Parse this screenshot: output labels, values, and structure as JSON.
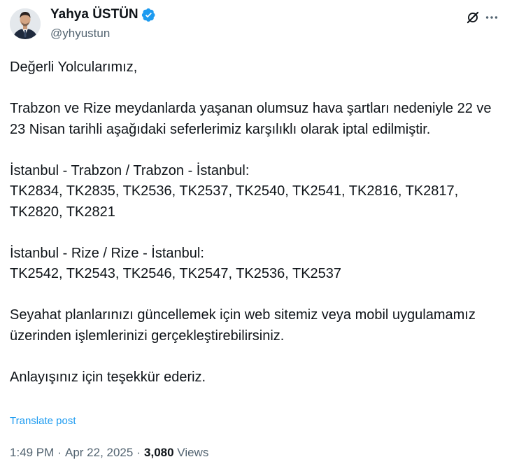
{
  "author": {
    "display_name": "Yahya ÜSTÜN",
    "handle": "@yhyustun",
    "verified": true,
    "verified_color": "#1d9bf0"
  },
  "header_actions": {
    "grok_icon": "grok-icon",
    "more_icon": "more-dots-icon"
  },
  "post": {
    "paragraphs": [
      "Değerli Yolcularımız,",
      "Trabzon ve Rize meydanlarda yaşanan olumsuz hava şartları nedeniyle 22 ve 23 Nisan tarihli aşağıdaki seferlerimiz karşılıklı olarak iptal edilmiştir.",
      "İstanbul - Trabzon / Trabzon - İstanbul:\nTK2834, TK2835, TK2536, TK2537, TK2540, TK2541, TK2816, TK2817, TK2820, TK2821",
      "İstanbul - Rize / Rize - İstanbul:\nTK2542, TK2543, TK2546, TK2547, TK2536, TK2537",
      "Seyahat planlarınızı güncellemek için web sitemiz veya mobil uygulamamız üzerinden işlemlerinizi gerçekleştirebilirsiniz.",
      "Anlayışınız için teşekkür ederiz."
    ],
    "translate_label": "Translate post"
  },
  "meta": {
    "time": "1:49 PM",
    "separator": "·",
    "date": "Apr 22, 2025",
    "views_count": "3,080",
    "views_label": "Views"
  },
  "colors": {
    "text": "#0f1419",
    "secondary": "#536471",
    "accent": "#1d9bf0"
  }
}
